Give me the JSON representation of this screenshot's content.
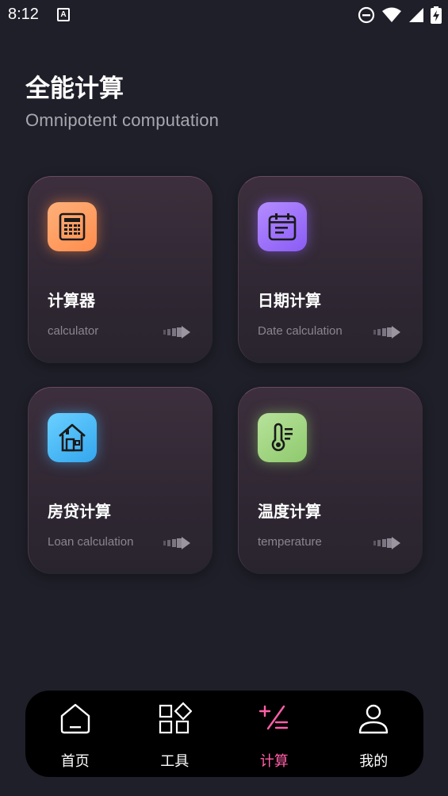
{
  "status_bar": {
    "time": "8:12",
    "notification_glyph": "A",
    "icons": [
      "do-not-disturb-icon",
      "wifi-icon",
      "signal-icon",
      "battery-charging-icon"
    ]
  },
  "header": {
    "title": "全能计算",
    "subtitle": "Omnipotent computation"
  },
  "cards": [
    {
      "title": "计算器",
      "subtitle": "calculator",
      "icon": "calculator-icon",
      "color": "#ff9a5e"
    },
    {
      "title": "日期计算",
      "subtitle": "Date calculation",
      "icon": "calendar-icon",
      "color": "#9d70fb"
    },
    {
      "title": "房贷计算",
      "subtitle": "Loan calculation",
      "icon": "house-icon",
      "color": "#48b8f3"
    },
    {
      "title": "温度计算",
      "subtitle": "temperature",
      "icon": "thermometer-icon",
      "color": "#a3d582"
    }
  ],
  "bottom_nav": {
    "items": [
      {
        "label": "首页",
        "icon": "home-icon"
      },
      {
        "label": "工具",
        "icon": "tools-grid-icon"
      },
      {
        "label": "计算",
        "icon": "calculate-icon",
        "active": true
      },
      {
        "label": "我的",
        "icon": "profile-icon"
      }
    ],
    "active_color": "#ff5fa8"
  }
}
